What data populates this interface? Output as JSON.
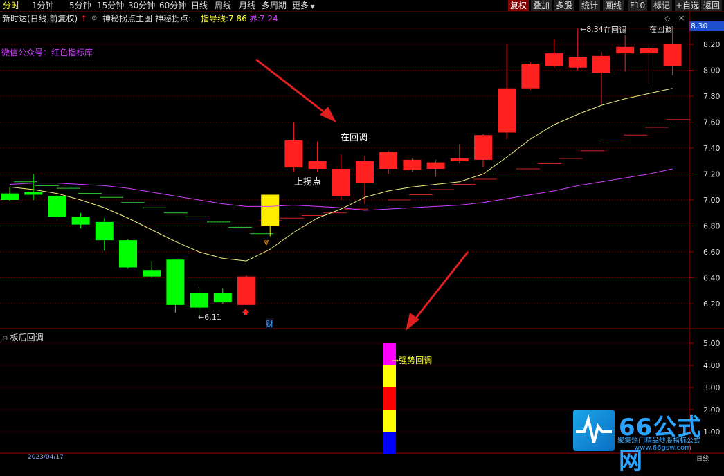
{
  "toolbar": {
    "left_items": [
      "分时",
      "1分钟",
      "5分钟",
      "15分钟",
      "30分钟",
      "60分钟",
      "日线",
      "周线",
      "月线",
      "多周期",
      "更多"
    ],
    "right_items": [
      "复权",
      "叠加",
      "多股",
      "统计",
      "画线",
      "F10",
      "标记",
      "+自选",
      "返回"
    ]
  },
  "header": {
    "stock_info": "新时达(日线,前复权)",
    "indicator_name": "神秘拐点主图",
    "indicator_label": "神秘拐点:",
    "indicator_dash": "-",
    "guide_label": "指导线:",
    "guide_value": "7.86",
    "bound_label": "界:",
    "bound_value": "7.24",
    "wechat": "微信公众号：红色指标库"
  },
  "colors": {
    "up": "#ff2020",
    "down": "#00ff00",
    "yellow_line": "#f0f080",
    "magenta_line": "#d040ff",
    "grid": "#7a0000"
  },
  "main_chart": {
    "current_price": "8.30",
    "price_ticks": [
      "8.20",
      "8.00",
      "7.80",
      "7.60",
      "7.40",
      "7.20",
      "7.00",
      "6.80",
      "6.60",
      "6.40",
      "6.20"
    ],
    "annotations": {
      "low_marker": "←6.11",
      "high_marker": "←8.34",
      "pullback_1": "在回调",
      "turn_point": "上拐点",
      "pullback_2": "在回调",
      "pullback_3": "在回调",
      "cai_badge": "财"
    },
    "candles": [
      {
        "o": 7.05,
        "c": 7.0,
        "h": 7.1,
        "l": 6.99
      },
      {
        "o": 7.06,
        "c": 7.04,
        "h": 7.2,
        "l": 7.0
      },
      {
        "o": 7.03,
        "c": 6.87,
        "h": 7.04,
        "l": 6.86
      },
      {
        "o": 6.87,
        "c": 6.81,
        "h": 6.9,
        "l": 6.78
      },
      {
        "o": 6.83,
        "c": 6.69,
        "h": 6.86,
        "l": 6.61
      },
      {
        "o": 6.69,
        "c": 6.48,
        "h": 6.7,
        "l": 6.47
      },
      {
        "o": 6.46,
        "c": 6.41,
        "h": 6.53,
        "l": 6.4
      },
      {
        "o": 6.54,
        "c": 6.19,
        "h": 6.54,
        "l": 6.13
      },
      {
        "o": 6.28,
        "c": 6.17,
        "h": 6.33,
        "l": 6.11
      },
      {
        "o": 6.28,
        "c": 6.21,
        "h": 6.32,
        "l": 6.2
      },
      {
        "o": 6.19,
        "c": 6.41,
        "h": 6.42,
        "l": 6.19
      },
      {
        "o": 6.8,
        "c": 7.04,
        "h": 7.04,
        "l": 6.72,
        "special": "yellow"
      },
      {
        "o": 7.25,
        "c": 7.46,
        "h": 7.6,
        "l": 7.22
      },
      {
        "o": 7.24,
        "c": 7.3,
        "h": 7.45,
        "l": 7.22
      },
      {
        "o": 7.03,
        "c": 7.24,
        "h": 7.35,
        "l": 7.0
      },
      {
        "o": 7.13,
        "c": 7.3,
        "h": 7.34,
        "l": 6.97
      },
      {
        "o": 7.24,
        "c": 7.37,
        "h": 7.38,
        "l": 7.2
      },
      {
        "o": 7.23,
        "c": 7.31,
        "h": 7.32,
        "l": 7.22
      },
      {
        "o": 7.24,
        "c": 7.29,
        "h": 7.31,
        "l": 7.18
      },
      {
        "o": 7.3,
        "c": 7.32,
        "h": 7.43,
        "l": 7.28
      },
      {
        "o": 7.31,
        "c": 7.5,
        "h": 7.51,
        "l": 7.25
      },
      {
        "o": 7.52,
        "c": 7.86,
        "h": 8.2,
        "l": 7.47
      },
      {
        "o": 7.86,
        "c": 8.05,
        "h": 8.06,
        "l": 7.85
      },
      {
        "o": 8.03,
        "c": 8.13,
        "h": 8.24,
        "l": 8.02
      },
      {
        "o": 8.02,
        "c": 8.1,
        "h": 8.32,
        "l": 8.0
      },
      {
        "o": 7.98,
        "c": 8.11,
        "h": 8.14,
        "l": 7.74
      },
      {
        "o": 8.13,
        "c": 8.18,
        "h": 8.27,
        "l": 7.99
      },
      {
        "o": 8.13,
        "c": 8.17,
        "h": 8.2,
        "l": 7.89
      },
      {
        "o": 8.03,
        "c": 8.2,
        "h": 8.34,
        "l": 7.96
      }
    ],
    "yellow_line": [
      7.1,
      7.08,
      7.05,
      7.0,
      6.94,
      6.86,
      6.77,
      6.68,
      6.6,
      6.55,
      6.53,
      6.62,
      6.75,
      6.86,
      6.93,
      7.02,
      7.07,
      7.1,
      7.12,
      7.14,
      7.2,
      7.33,
      7.47,
      7.58,
      7.66,
      7.73,
      7.78,
      7.82,
      7.86
    ],
    "magenta_line": [
      7.12,
      7.13,
      7.13,
      7.12,
      7.11,
      7.09,
      7.06,
      7.03,
      7.0,
      6.97,
      6.95,
      6.95,
      6.96,
      6.95,
      6.94,
      6.92,
      6.93,
      6.94,
      6.95,
      6.96,
      6.98,
      7.01,
      7.04,
      7.07,
      7.11,
      7.14,
      7.17,
      7.2,
      7.24
    ],
    "steps_green": [
      7.14,
      7.11,
      7.09,
      7.05,
      7.02,
      6.98,
      6.94,
      6.9,
      6.87,
      6.83,
      6.79,
      6.74
    ],
    "steps_red": [
      6.84,
      6.86,
      6.88,
      6.9,
      6.93,
      6.96,
      7.0,
      7.04,
      7.08,
      7.12,
      7.16,
      7.2,
      7.24,
      7.28,
      7.32,
      7.38,
      7.44,
      7.5,
      7.56,
      7.62
    ]
  },
  "sub_chart": {
    "title": "板后回调",
    "ticks": [
      "5.00",
      "4.00",
      "3.00",
      "2.00",
      "1.00"
    ],
    "label": "强势回调",
    "bar_colors": [
      "#ff00ff",
      "#ffff00",
      "#ff0000",
      "#ffff00",
      "#0000ff"
    ]
  },
  "logo": {
    "text": "66公式网",
    "subtitle": "聚集热门精品炒股指标公式",
    "url": "www.66gsw.com"
  },
  "bottom": {
    "date": "2023/04/17",
    "period": "日线"
  }
}
